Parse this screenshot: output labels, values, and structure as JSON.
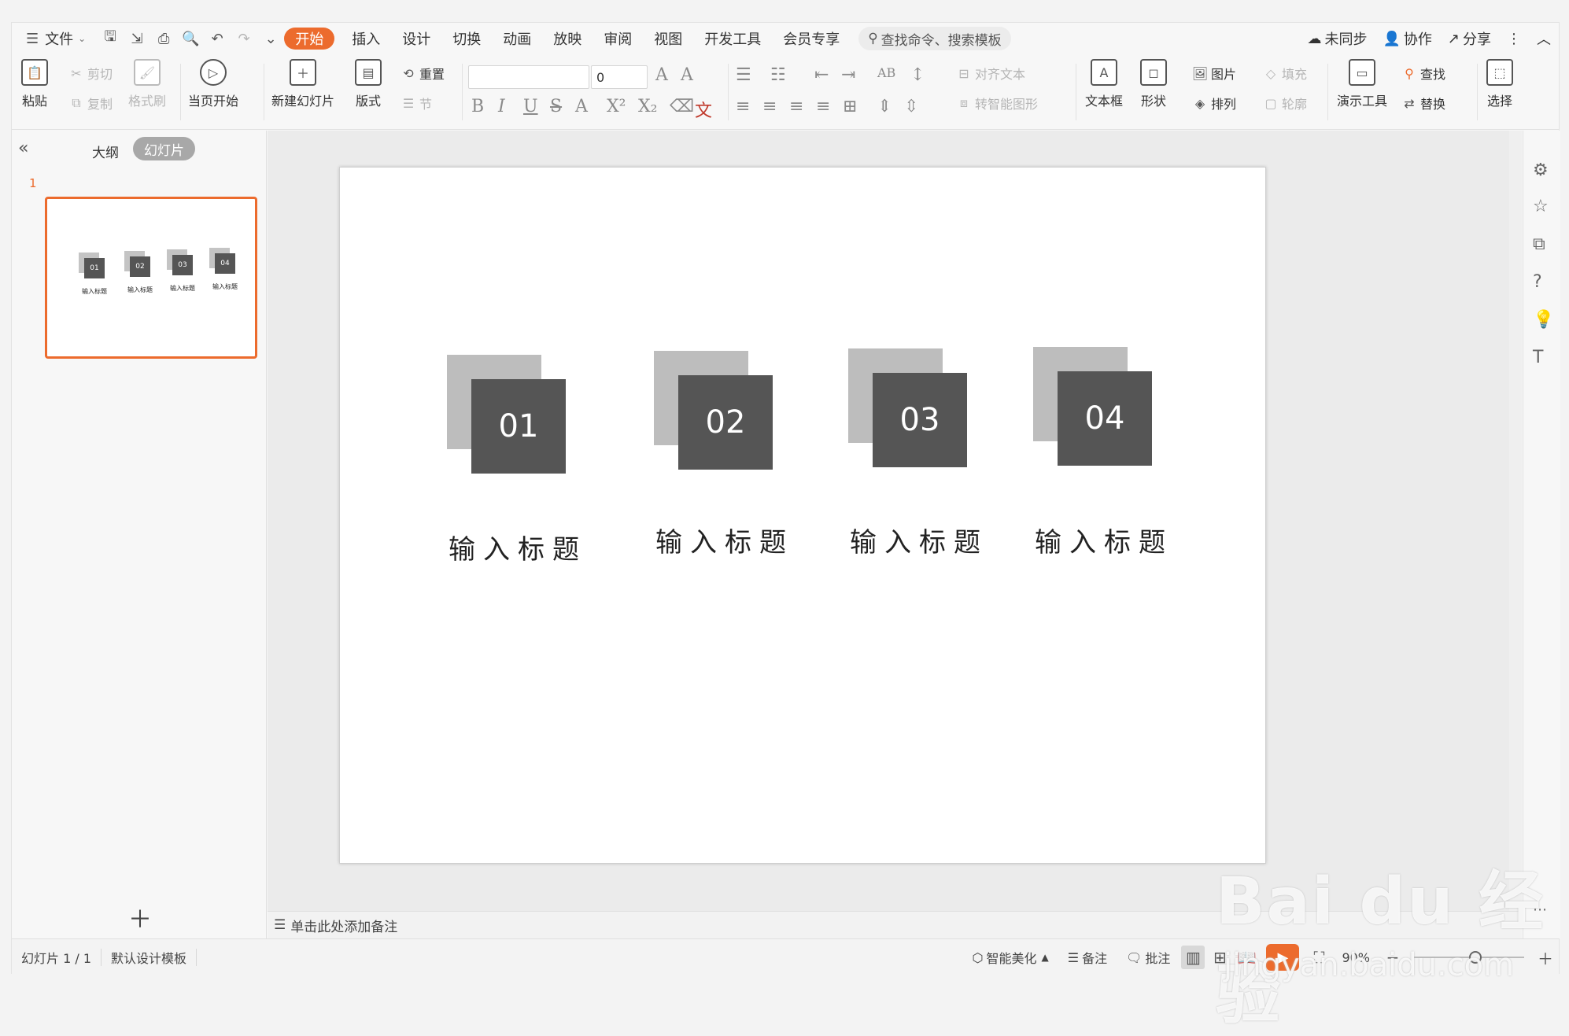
{
  "menubar": {
    "file": "文件",
    "tabs": [
      "开始",
      "插入",
      "设计",
      "切换",
      "动画",
      "放映",
      "审阅",
      "视图",
      "开发工具",
      "会员专享"
    ],
    "search_placeholder": "查找命令、搜索模板",
    "unsync": "未同步",
    "collab": "协作",
    "share": "分享"
  },
  "ribbon": {
    "paste": "粘贴",
    "cut": "剪切",
    "copy": "复制",
    "format_painter": "格式刷",
    "from_current": "当页开始",
    "new_slide": "新建幻灯片",
    "layout": "版式",
    "reset": "重置",
    "section": "节",
    "font_size": "0",
    "align_text": "对齐文本",
    "smartart": "转智能图形",
    "textbox": "文本框",
    "shape": "形状",
    "picture": "图片",
    "arrange": "排列",
    "fill": "填充",
    "outline": "轮廓",
    "presenter": "演示工具",
    "find": "查找",
    "replace": "替换",
    "select": "选择"
  },
  "leftpanel": {
    "tab_outline": "大纲",
    "tab_slides": "幻灯片",
    "slide_number": "1"
  },
  "slide": {
    "items": [
      {
        "num": "01",
        "title": "输入标题"
      },
      {
        "num": "02",
        "title": "输入标题"
      },
      {
        "num": "03",
        "title": "输入标题"
      },
      {
        "num": "04",
        "title": "输入标题"
      }
    ]
  },
  "notes_placeholder": "单击此处添加备注",
  "status": {
    "slide_count": "幻灯片 1 / 1",
    "template": "默认设计模板",
    "beautify": "智能美化",
    "notes": "备注",
    "comments": "批注",
    "zoom": "90%"
  },
  "watermark": {
    "brand": "Bai du 经验",
    "url": "jingyan.baidu.com"
  },
  "colors": {
    "accent": "#ec6b2d",
    "square_front": "#555555",
    "square_back": "#bdbdbd"
  }
}
